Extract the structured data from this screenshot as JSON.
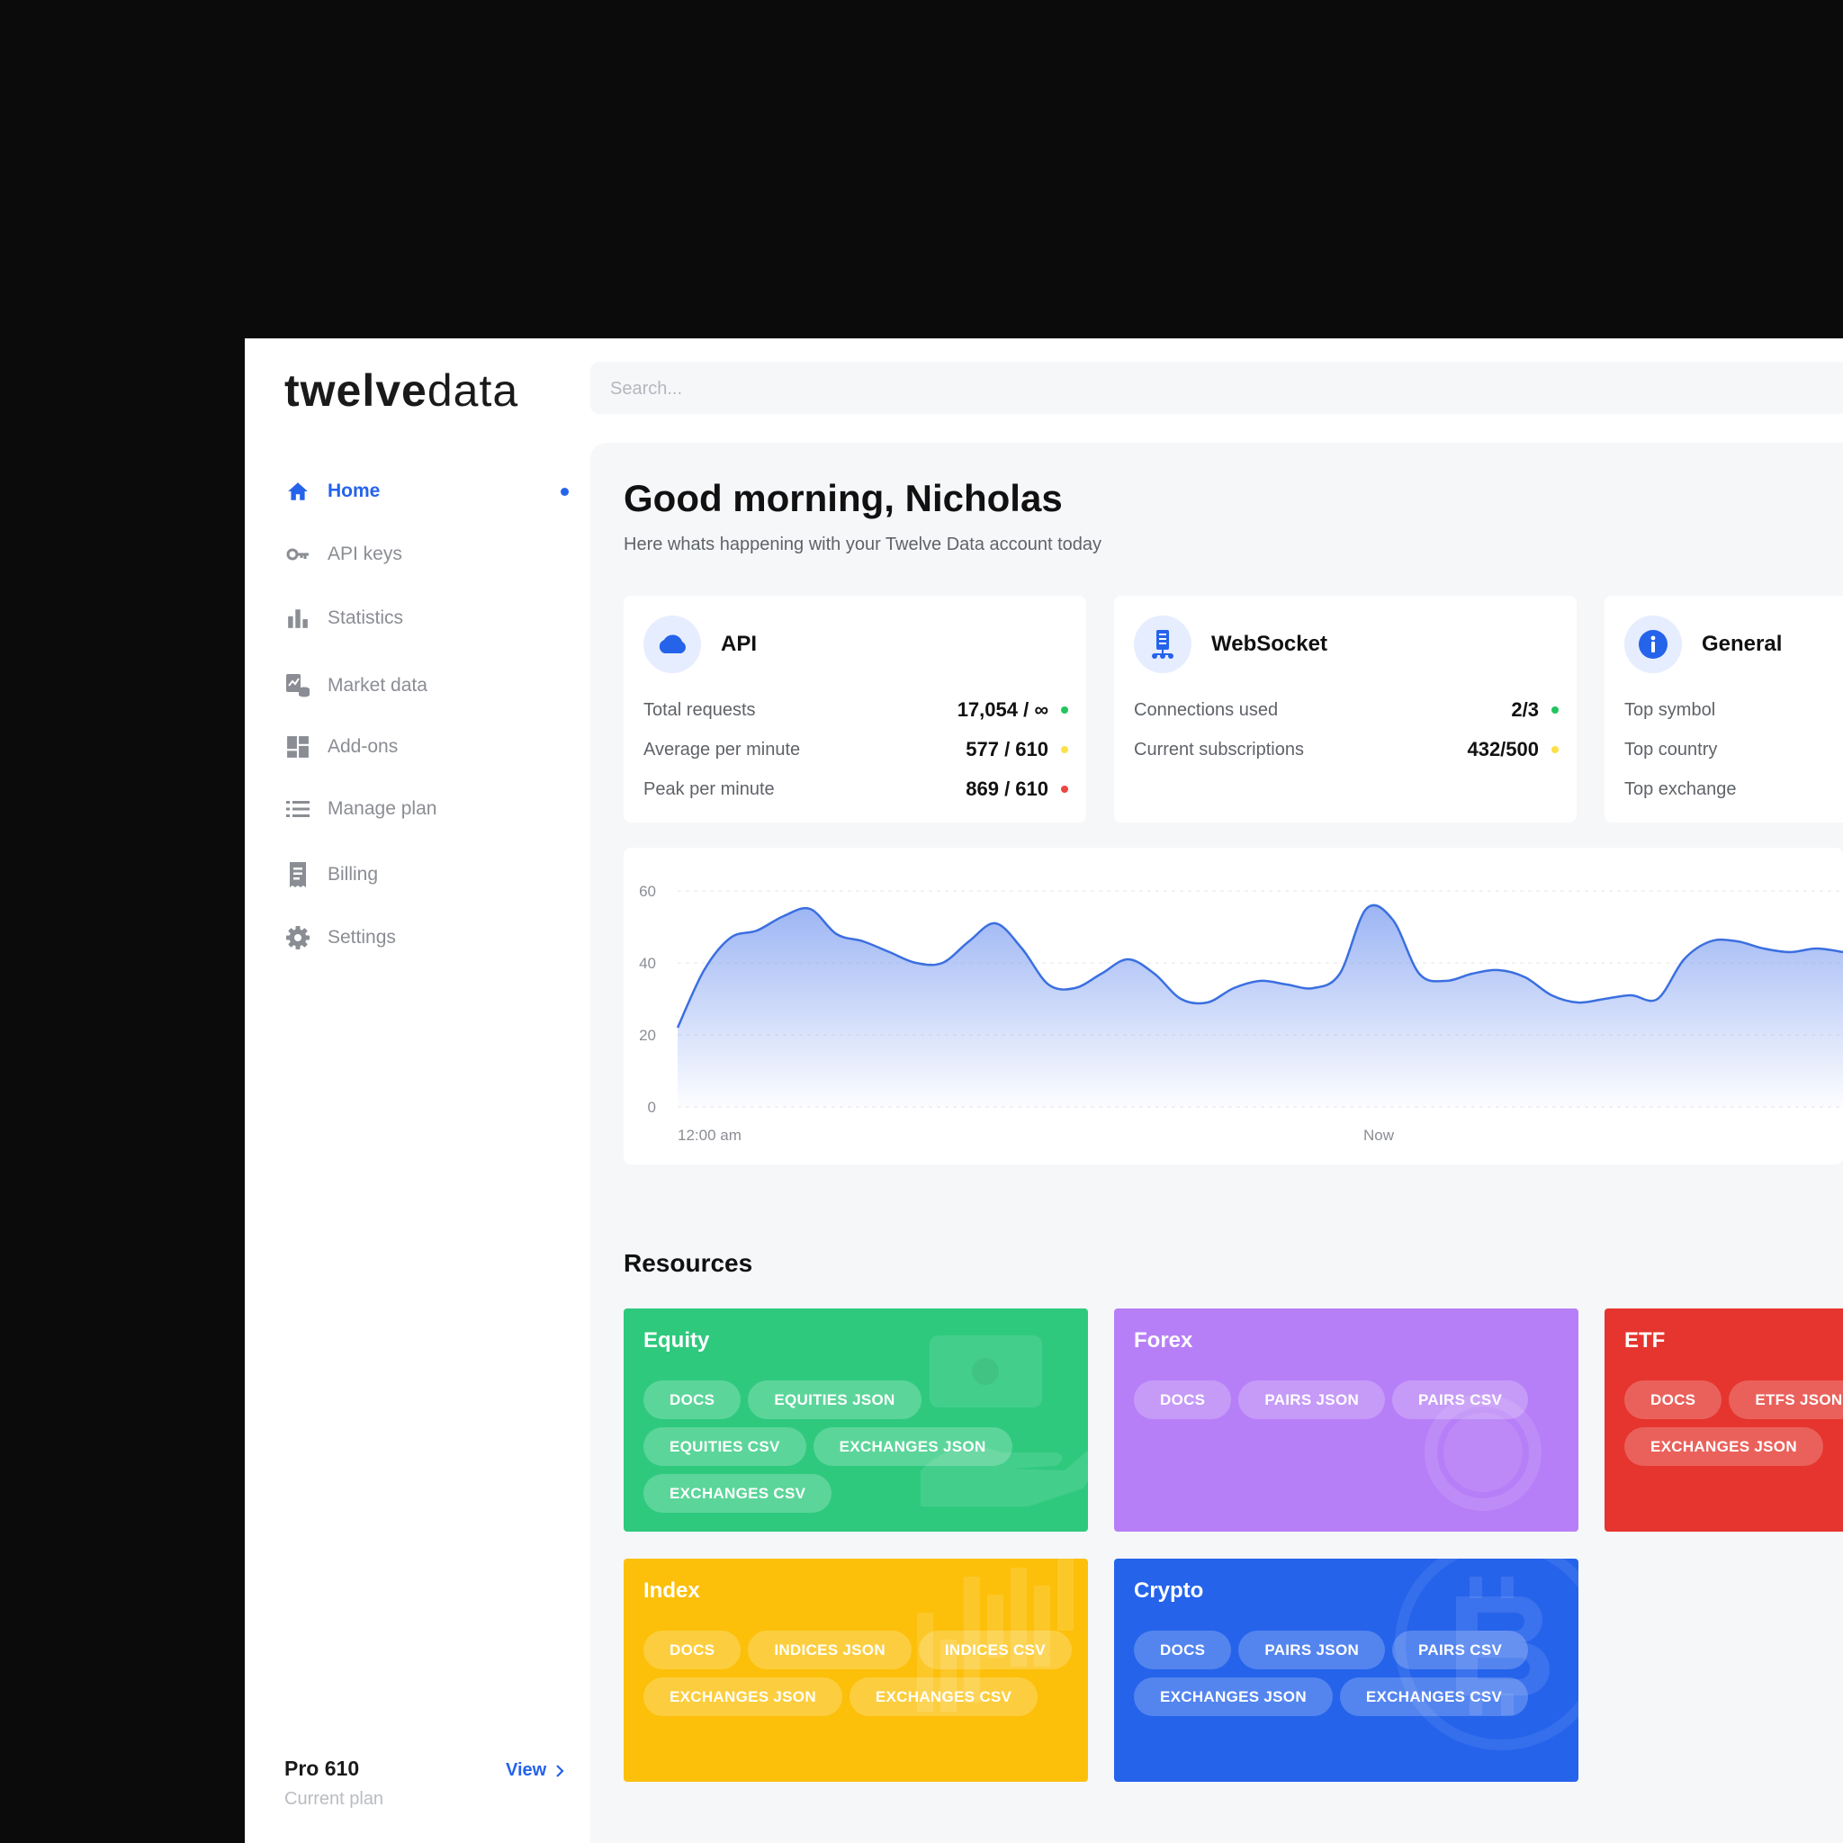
{
  "brand": {
    "bold": "twelve",
    "light": "data"
  },
  "search": {
    "placeholder": "Search..."
  },
  "sidebar": {
    "items": [
      {
        "label": "Home",
        "icon": "home-icon",
        "active": true
      },
      {
        "label": "API keys",
        "icon": "key-icon"
      },
      {
        "label": "Statistics",
        "icon": "bar-chart-icon"
      },
      {
        "label": "Market data",
        "icon": "market-data-icon"
      },
      {
        "label": "Add-ons",
        "icon": "grid-icon"
      },
      {
        "label": "Manage plan",
        "icon": "list-icon"
      },
      {
        "label": "Billing",
        "icon": "receipt-icon"
      },
      {
        "label": "Settings",
        "icon": "gear-icon"
      }
    ],
    "plan": {
      "name": "Pro 610",
      "subtitle": "Current plan",
      "view_label": "View"
    }
  },
  "main": {
    "greeting": "Good morning, Nicholas",
    "subtitle": "Here whats happening with your Twelve Data account today",
    "cards": {
      "api": {
        "title": "API",
        "icon": "cloud-icon",
        "stats": [
          {
            "label": "Total requests",
            "value": "17,054 / ∞",
            "status": "#22c55e"
          },
          {
            "label": "Average per minute",
            "value": "577 / 610",
            "status": "#fde047"
          },
          {
            "label": "Peak per minute",
            "value": "869 / 610",
            "status": "#ef4444"
          }
        ]
      },
      "websocket": {
        "title": "WebSocket",
        "icon": "server-icon",
        "stats": [
          {
            "label": "Connections used",
            "value": "2/3",
            "status": "#22c55e"
          },
          {
            "label": "Current subscriptions",
            "value": "432/500",
            "status": "#fde047"
          }
        ]
      },
      "general": {
        "title": "General",
        "icon": "info-icon",
        "stats": [
          {
            "label": "Top symbol"
          },
          {
            "label": "Top country"
          },
          {
            "label": "Top exchange"
          }
        ]
      }
    },
    "resources": {
      "title": "Resources",
      "cards": [
        {
          "name": "Equity",
          "color": "#2fc97e",
          "tags": [
            "DOCS",
            "EQUITIES JSON",
            "EQUITIES CSV",
            "EXCHANGES JSON",
            "EXCHANGES CSV"
          ]
        },
        {
          "name": "Forex",
          "color": "#b77ff7",
          "tags": [
            "DOCS",
            "PAIRS JSON",
            "PAIRS CSV"
          ]
        },
        {
          "name": "ETF",
          "color": "#e5352e",
          "tags": [
            "DOCS",
            "ETFS JSON",
            "EXCHANGES JSON"
          ]
        },
        {
          "name": "Index",
          "color": "#fcc00a",
          "tags": [
            "DOCS",
            "INDICES JSON",
            "INDICES CSV",
            "EXCHANGES JSON",
            "EXCHANGES CSV"
          ]
        },
        {
          "name": "Crypto",
          "color": "#2563eb",
          "tags": [
            "DOCS",
            "PAIRS JSON",
            "PAIRS CSV",
            "EXCHANGES JSON",
            "EXCHANGES CSV"
          ]
        }
      ]
    }
  },
  "chart_data": {
    "type": "area",
    "ylim": [
      0,
      60
    ],
    "yticks": [
      0,
      20,
      40,
      60
    ],
    "xtick_labels": [
      "12:00 am",
      "Now"
    ],
    "series": [
      {
        "values": [
          22,
          38,
          47,
          49,
          53,
          55,
          48,
          46,
          43,
          40,
          40,
          46,
          51,
          44,
          34,
          33,
          37,
          41,
          37,
          30,
          29,
          33,
          35,
          34,
          33,
          37,
          55,
          52,
          37,
          35,
          37,
          38,
          36,
          31,
          29,
          30,
          31,
          30,
          41,
          46,
          46,
          44,
          43,
          44,
          43
        ]
      }
    ],
    "colors": {
      "line": "#3b6fe0",
      "fill": "#7b9cf0"
    }
  }
}
